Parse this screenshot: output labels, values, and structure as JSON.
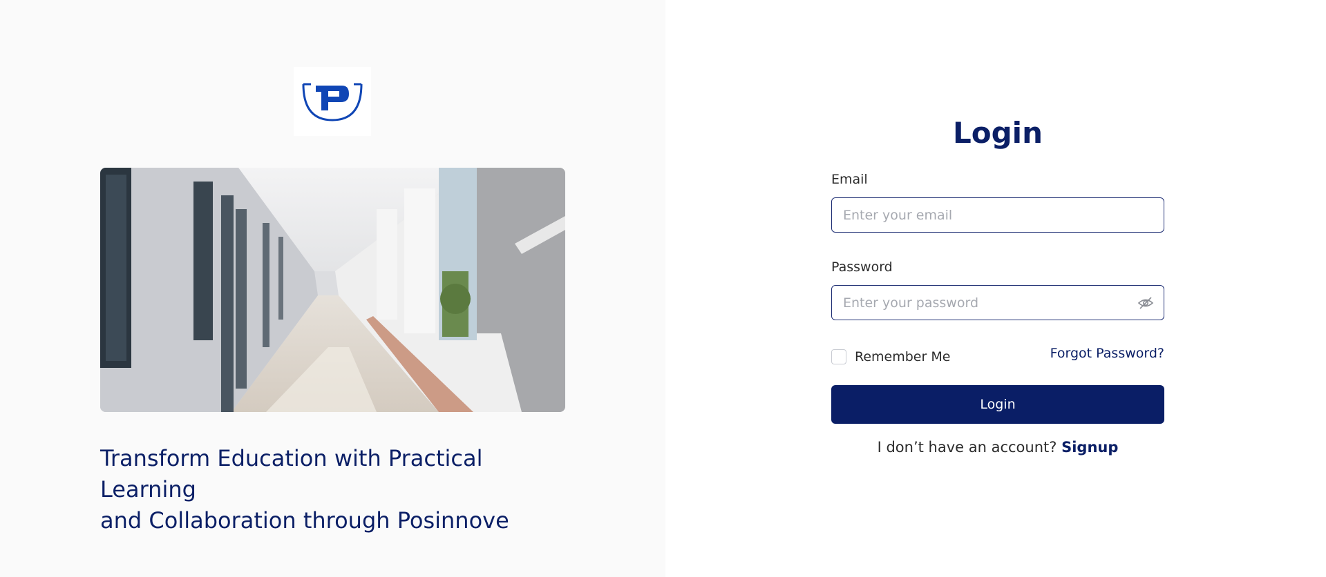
{
  "brand": {
    "logo_letter": "P",
    "logo_color": "#1046b5"
  },
  "hero": {
    "tagline_line1": "Transform Education with Practical Learning",
    "tagline_line2": "and Collaboration through Posinnove"
  },
  "form": {
    "title": "Login",
    "email_label": "Email",
    "email_placeholder": "Enter your email",
    "password_label": "Password",
    "password_placeholder": "Enter your password",
    "remember_label": "Remember Me",
    "forgot_label": "Forgot Password?",
    "submit_label": "Login",
    "signup_prompt": "I don’t have an account?",
    "signup_link": "Signup"
  },
  "colors": {
    "primary": "#0a1e66",
    "accent": "#0b1f66",
    "left_bg": "#fafafa"
  },
  "icons": {
    "password_toggle": "eye-off-icon",
    "checkbox": "checkbox-unchecked-icon"
  }
}
